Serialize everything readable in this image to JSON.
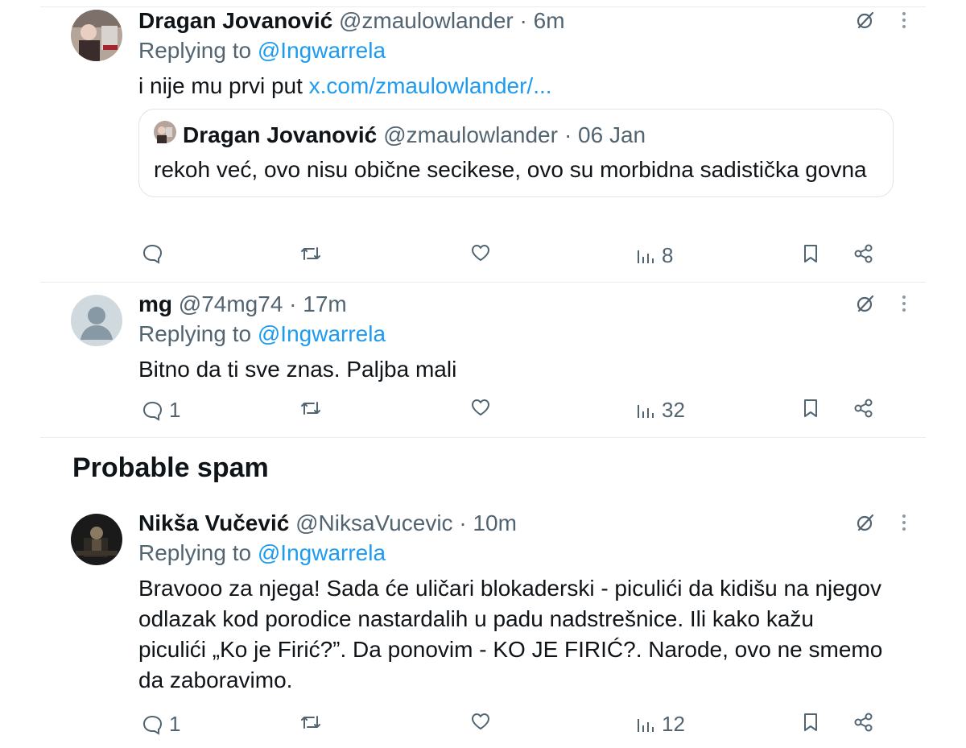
{
  "tweets": [
    {
      "name": "Dragan Jovanović",
      "handle": "@zmaulowlander",
      "time": "· 6m",
      "replying_prefix": "Replying to",
      "replying_to": "@Ingwarrela",
      "text": "i nije mu prvi put",
      "link": "x.com/zmaulowlander/...",
      "quote": {
        "name": "Dragan Jovanović",
        "handle": "@zmaulowlander",
        "time": "· 06 Jan",
        "text": "rekoh već, ovo nisu obične secikese, ovo su morbidna sadistička govna"
      },
      "stats": {
        "replies": "",
        "views": "8"
      }
    },
    {
      "name": "mg",
      "handle": "@74mg74",
      "time": "· 17m",
      "replying_prefix": "Replying to",
      "replying_to": "@Ingwarrela",
      "text": "Bitno da ti sve znas. Paljba mali",
      "stats": {
        "replies": "1",
        "views": "32"
      }
    },
    {
      "name": "Nikša Vučević",
      "handle": "@NiksaVucevic",
      "time": "· 10m",
      "replying_prefix": "Replying to",
      "replying_to": "@Ingwarrela",
      "text": "Bravooo za njega! Sada će uličari blokaderski - piculići da kidišu na njegov odlazak kod porodice nastardalih u padu nadstrešnice. Ili kako kažu piculići „Ko je Firić?”. Da ponovim - KO JE FIRIĆ?. Narode, ovo ne smemo da zaboravimo.",
      "stats": {
        "replies": "1",
        "views": "12"
      }
    }
  ],
  "section_title": "Probable spam",
  "icons": [
    "reply-icon",
    "retweet-icon",
    "like-icon",
    "views-icon",
    "bookmark-icon",
    "share-icon",
    "grok-icon",
    "more-icon"
  ],
  "colors": {
    "link": "#1d9bf0",
    "muted": "#536471",
    "text": "#0f1419"
  }
}
